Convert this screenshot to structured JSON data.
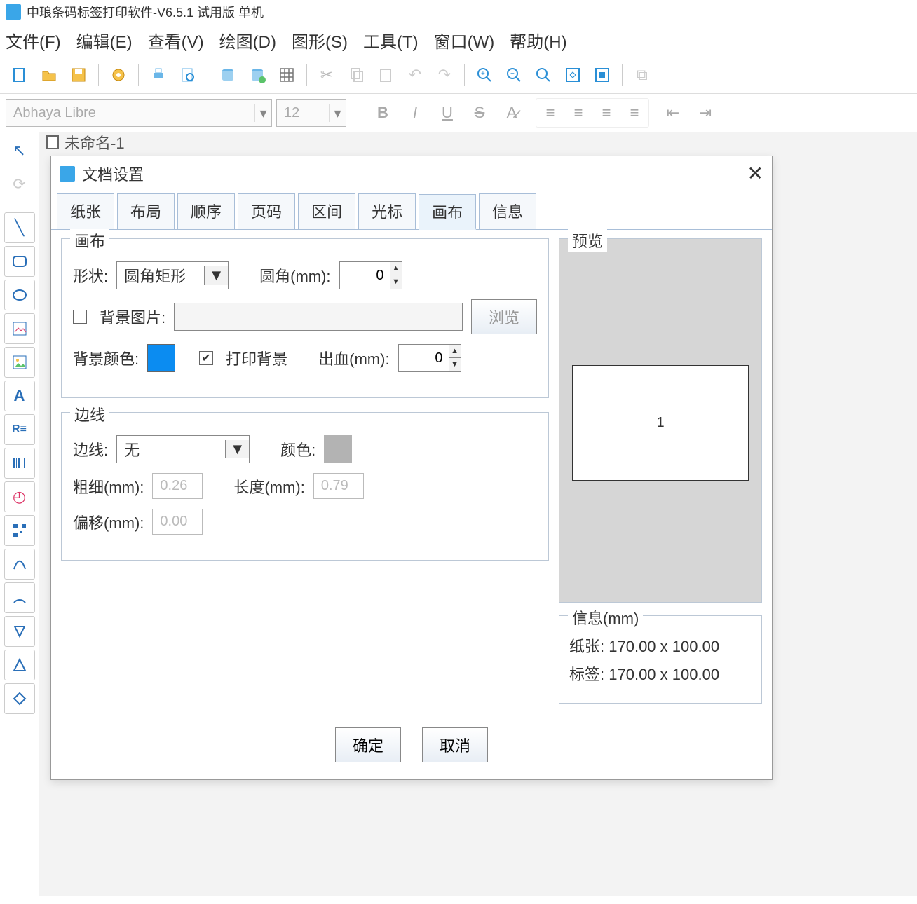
{
  "app": {
    "title": "中琅条码标签打印软件-V6.5.1 试用版 单机"
  },
  "menus": {
    "file": "文件(F)",
    "edit": "编辑(E)",
    "view": "查看(V)",
    "draw": "绘图(D)",
    "shape": "图形(S)",
    "tool": "工具(T)",
    "window": "窗口(W)",
    "help": "帮助(H)"
  },
  "fontbar": {
    "font": "Abhaya Libre",
    "size": "12"
  },
  "doc": {
    "tab": "未命名-1"
  },
  "dialog": {
    "title": "文档设置",
    "tabs": [
      "纸张",
      "布局",
      "顺序",
      "页码",
      "区间",
      "光标",
      "画布",
      "信息"
    ],
    "active_tab": 6,
    "canvas": {
      "legend": "画布",
      "shape_label": "形状:",
      "shape_value": "圆角矩形",
      "radius_label": "圆角(mm):",
      "radius_value": "0",
      "bgimage_label": "背景图片:",
      "bgimage_value": "",
      "browse": "浏览",
      "bgcolor_label": "背景颜色:",
      "bgcolor": "#0b8cf1",
      "print_bg_label": "打印背景",
      "print_bg_checked": true,
      "bleed_label": "出血(mm):",
      "bleed_value": "0"
    },
    "border": {
      "legend": "边线",
      "border_label": "边线:",
      "border_value": "无",
      "color_label": "颜色:",
      "color": "#b3b3b3",
      "thickness_label": "粗细(mm):",
      "thickness_value": "0.26",
      "length_label": "长度(mm):",
      "length_value": "0.79",
      "offset_label": "偏移(mm):",
      "offset_value": "0.00"
    },
    "preview": {
      "legend": "预览",
      "page_num": "1"
    },
    "info": {
      "legend": "信息(mm)",
      "paper_label": "纸张:",
      "paper_value": "170.00 x 100.00",
      "label_label": "标签:",
      "label_value": "170.00 x 100.00"
    },
    "ok": "确定",
    "cancel": "取消"
  }
}
